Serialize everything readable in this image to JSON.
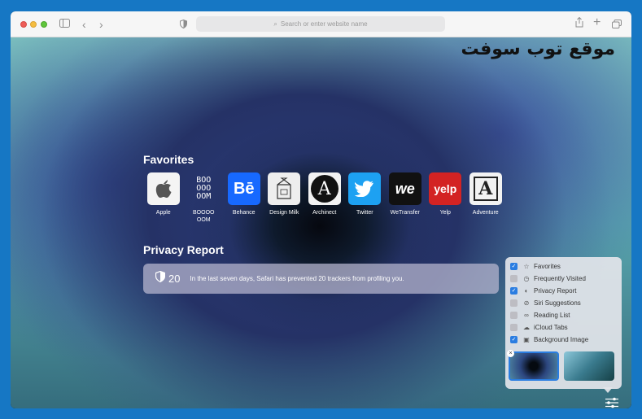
{
  "toolbar": {
    "address_placeholder": "Search or enter website name"
  },
  "watermark": "موقع توب سوفت",
  "favorites": {
    "title": "Favorites",
    "items": [
      {
        "label": "Apple",
        "tile_bg": "#f4f4f4"
      },
      {
        "label": "BOOOOOOM",
        "tile_text": "BOO\nOOO\nOOM",
        "tile_bg": "transparent"
      },
      {
        "label": "Behance",
        "tile_text": "Bē",
        "tile_bg": "#1769ff"
      },
      {
        "label": "Design Milk",
        "tile_bg": "#eeeeee"
      },
      {
        "label": "Archinect",
        "tile_text": "A",
        "tile_bg": "#f2f2f2"
      },
      {
        "label": "Twitter",
        "tile_bg": "#1da1f2"
      },
      {
        "label": "WeTransfer",
        "tile_text": "we",
        "tile_bg": "#111111"
      },
      {
        "label": "Yelp",
        "tile_text": "yelp",
        "tile_bg": "#d32323"
      },
      {
        "label": "Adventure",
        "tile_text": "A",
        "tile_bg": "#f2f2f2"
      }
    ]
  },
  "privacy": {
    "title": "Privacy Report",
    "count": "20",
    "message": "In the last seven days, Safari has prevented 20 trackers from profiling you."
  },
  "customize": {
    "options": [
      {
        "label": "Favorites",
        "checked": true,
        "icon": "star-icon"
      },
      {
        "label": "Frequently Visited",
        "checked": false,
        "icon": "clock-icon"
      },
      {
        "label": "Privacy Report",
        "checked": true,
        "icon": "shield-icon"
      },
      {
        "label": "Siri Suggestions",
        "checked": false,
        "icon": "compass-icon"
      },
      {
        "label": "Reading List",
        "checked": false,
        "icon": "glasses-icon"
      },
      {
        "label": "iCloud Tabs",
        "checked": false,
        "icon": "cloud-icon"
      },
      {
        "label": "Background Image",
        "checked": true,
        "icon": "image-icon"
      }
    ]
  },
  "colors": {
    "accent": "#2a7de1"
  }
}
